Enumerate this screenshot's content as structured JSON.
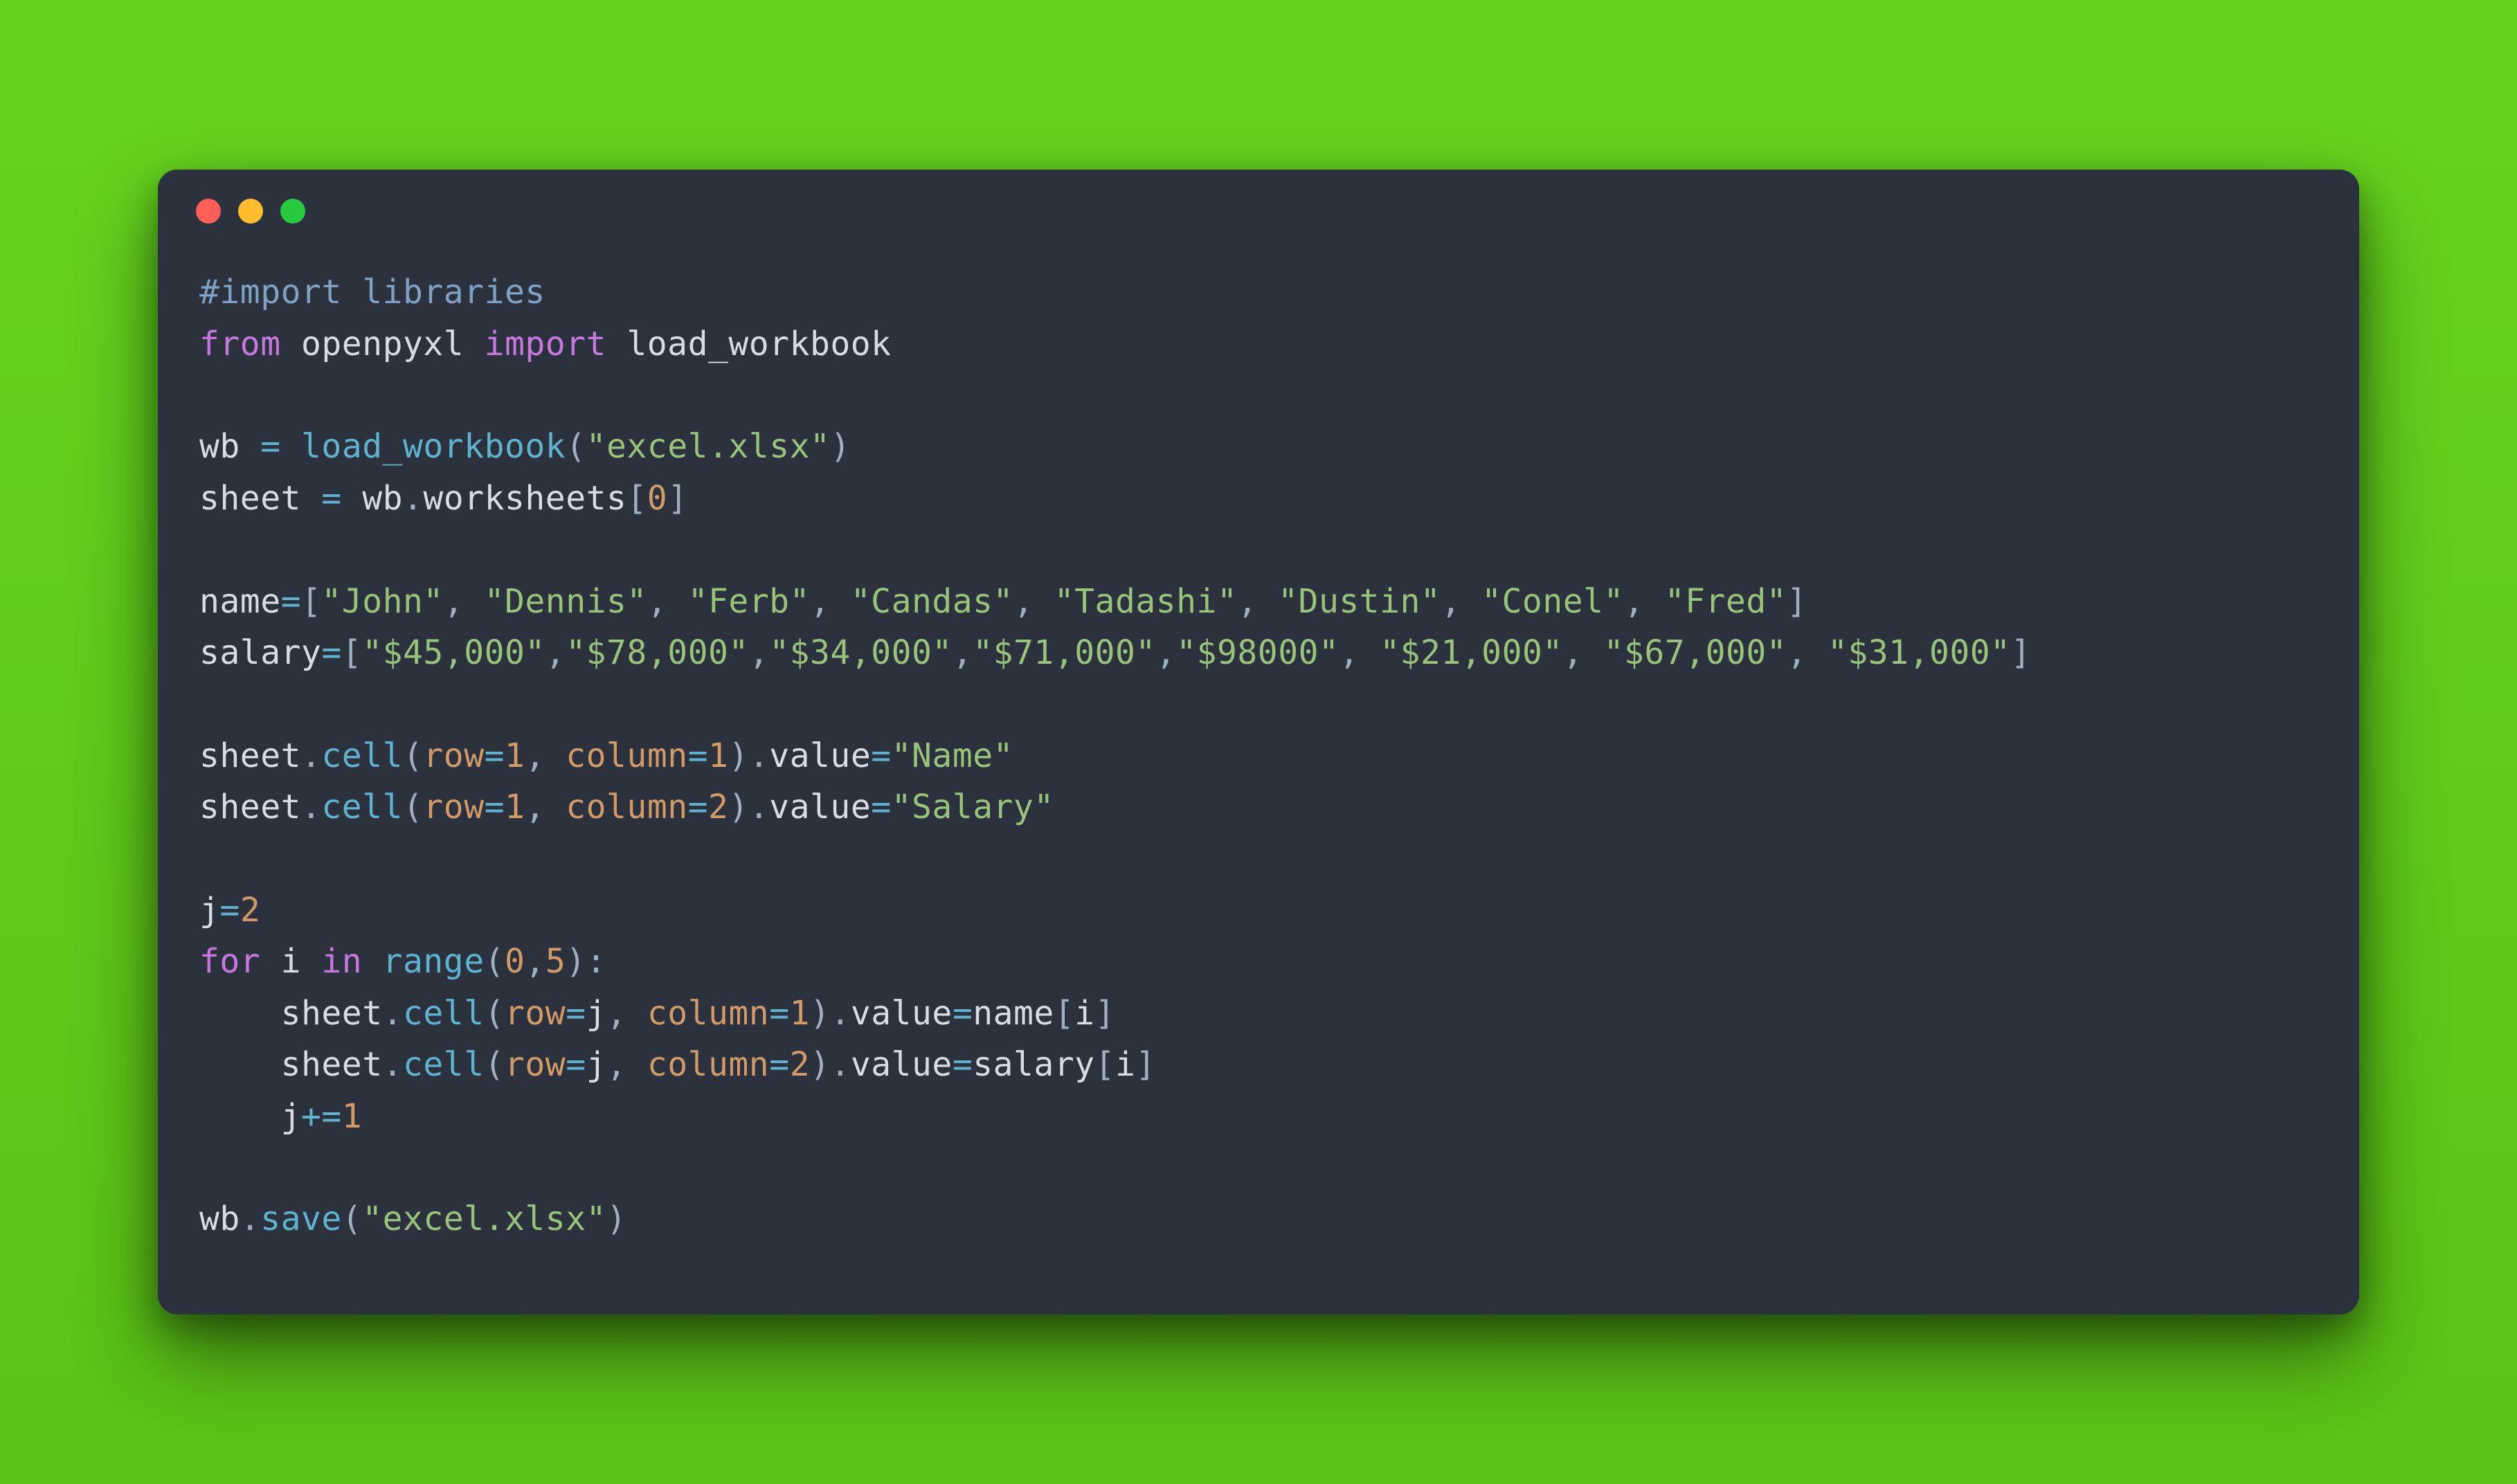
{
  "code": {
    "language": "python",
    "tokens": [
      [
        {
          "c": "tok-comment",
          "t": "#import libraries"
        }
      ],
      [
        {
          "c": "tok-kw",
          "t": "from"
        },
        {
          "c": "tok-ident",
          "t": " openpyxl "
        },
        {
          "c": "tok-kw",
          "t": "import"
        },
        {
          "c": "tok-ident",
          "t": " load_workbook"
        }
      ],
      [],
      [
        {
          "c": "tok-ident",
          "t": "wb "
        },
        {
          "c": "tok-op",
          "t": "="
        },
        {
          "c": "tok-ident",
          "t": " "
        },
        {
          "c": "tok-func",
          "t": "load_workbook"
        },
        {
          "c": "tok-punct",
          "t": "("
        },
        {
          "c": "tok-str",
          "t": "\"excel.xlsx\""
        },
        {
          "c": "tok-punct",
          "t": ")"
        }
      ],
      [
        {
          "c": "tok-ident",
          "t": "sheet "
        },
        {
          "c": "tok-op",
          "t": "="
        },
        {
          "c": "tok-ident",
          "t": " wb"
        },
        {
          "c": "tok-punct",
          "t": "."
        },
        {
          "c": "tok-ident",
          "t": "worksheets"
        },
        {
          "c": "tok-punct",
          "t": "["
        },
        {
          "c": "tok-num",
          "t": "0"
        },
        {
          "c": "tok-punct",
          "t": "]"
        }
      ],
      [],
      [
        {
          "c": "tok-ident",
          "t": "name"
        },
        {
          "c": "tok-op",
          "t": "="
        },
        {
          "c": "tok-punct",
          "t": "["
        },
        {
          "c": "tok-str",
          "t": "\"John\""
        },
        {
          "c": "tok-punct",
          "t": ", "
        },
        {
          "c": "tok-str",
          "t": "\"Dennis\""
        },
        {
          "c": "tok-punct",
          "t": ", "
        },
        {
          "c": "tok-str",
          "t": "\"Ferb\""
        },
        {
          "c": "tok-punct",
          "t": ", "
        },
        {
          "c": "tok-str",
          "t": "\"Candas\""
        },
        {
          "c": "tok-punct",
          "t": ", "
        },
        {
          "c": "tok-str",
          "t": "\"Tadashi\""
        },
        {
          "c": "tok-punct",
          "t": ", "
        },
        {
          "c": "tok-str",
          "t": "\"Dustin\""
        },
        {
          "c": "tok-punct",
          "t": ", "
        },
        {
          "c": "tok-str",
          "t": "\"Conel\""
        },
        {
          "c": "tok-punct",
          "t": ", "
        },
        {
          "c": "tok-str",
          "t": "\"Fred\""
        },
        {
          "c": "tok-punct",
          "t": "]"
        }
      ],
      [
        {
          "c": "tok-ident",
          "t": "salary"
        },
        {
          "c": "tok-op",
          "t": "="
        },
        {
          "c": "tok-punct",
          "t": "["
        },
        {
          "c": "tok-str",
          "t": "\"$45,000\""
        },
        {
          "c": "tok-punct",
          "t": ","
        },
        {
          "c": "tok-str",
          "t": "\"$78,000\""
        },
        {
          "c": "tok-punct",
          "t": ","
        },
        {
          "c": "tok-str",
          "t": "\"$34,000\""
        },
        {
          "c": "tok-punct",
          "t": ","
        },
        {
          "c": "tok-str",
          "t": "\"$71,000\""
        },
        {
          "c": "tok-punct",
          "t": ","
        },
        {
          "c": "tok-str",
          "t": "\"$98000\""
        },
        {
          "c": "tok-punct",
          "t": ", "
        },
        {
          "c": "tok-str",
          "t": "\"$21,000\""
        },
        {
          "c": "tok-punct",
          "t": ", "
        },
        {
          "c": "tok-str",
          "t": "\"$67,000\""
        },
        {
          "c": "tok-punct",
          "t": ", "
        },
        {
          "c": "tok-str",
          "t": "\"$31,000\""
        },
        {
          "c": "tok-punct",
          "t": "]"
        }
      ],
      [],
      [
        {
          "c": "tok-ident",
          "t": "sheet"
        },
        {
          "c": "tok-punct",
          "t": "."
        },
        {
          "c": "tok-func",
          "t": "cell"
        },
        {
          "c": "tok-punct",
          "t": "("
        },
        {
          "c": "tok-param",
          "t": "row"
        },
        {
          "c": "tok-op",
          "t": "="
        },
        {
          "c": "tok-num",
          "t": "1"
        },
        {
          "c": "tok-punct",
          "t": ", "
        },
        {
          "c": "tok-param",
          "t": "column"
        },
        {
          "c": "tok-op",
          "t": "="
        },
        {
          "c": "tok-num",
          "t": "1"
        },
        {
          "c": "tok-punct",
          "t": ")."
        },
        {
          "c": "tok-ident",
          "t": "value"
        },
        {
          "c": "tok-op",
          "t": "="
        },
        {
          "c": "tok-str",
          "t": "\"Name\""
        }
      ],
      [
        {
          "c": "tok-ident",
          "t": "sheet"
        },
        {
          "c": "tok-punct",
          "t": "."
        },
        {
          "c": "tok-func",
          "t": "cell"
        },
        {
          "c": "tok-punct",
          "t": "("
        },
        {
          "c": "tok-param",
          "t": "row"
        },
        {
          "c": "tok-op",
          "t": "="
        },
        {
          "c": "tok-num",
          "t": "1"
        },
        {
          "c": "tok-punct",
          "t": ", "
        },
        {
          "c": "tok-param",
          "t": "column"
        },
        {
          "c": "tok-op",
          "t": "="
        },
        {
          "c": "tok-num",
          "t": "2"
        },
        {
          "c": "tok-punct",
          "t": ")."
        },
        {
          "c": "tok-ident",
          "t": "value"
        },
        {
          "c": "tok-op",
          "t": "="
        },
        {
          "c": "tok-str",
          "t": "\"Salary\""
        }
      ],
      [],
      [
        {
          "c": "tok-ident",
          "t": "j"
        },
        {
          "c": "tok-op",
          "t": "="
        },
        {
          "c": "tok-num",
          "t": "2"
        }
      ],
      [
        {
          "c": "tok-kw",
          "t": "for"
        },
        {
          "c": "tok-ident",
          "t": " i "
        },
        {
          "c": "tok-kw",
          "t": "in"
        },
        {
          "c": "tok-ident",
          "t": " "
        },
        {
          "c": "tok-func",
          "t": "range"
        },
        {
          "c": "tok-punct",
          "t": "("
        },
        {
          "c": "tok-num",
          "t": "0"
        },
        {
          "c": "tok-punct",
          "t": ","
        },
        {
          "c": "tok-num",
          "t": "5"
        },
        {
          "c": "tok-punct",
          "t": "):"
        }
      ],
      [
        {
          "c": "tok-ident",
          "t": "    sheet"
        },
        {
          "c": "tok-punct",
          "t": "."
        },
        {
          "c": "tok-func",
          "t": "cell"
        },
        {
          "c": "tok-punct",
          "t": "("
        },
        {
          "c": "tok-param",
          "t": "row"
        },
        {
          "c": "tok-op",
          "t": "="
        },
        {
          "c": "tok-ident",
          "t": "j"
        },
        {
          "c": "tok-punct",
          "t": ", "
        },
        {
          "c": "tok-param",
          "t": "column"
        },
        {
          "c": "tok-op",
          "t": "="
        },
        {
          "c": "tok-num",
          "t": "1"
        },
        {
          "c": "tok-punct",
          "t": ")."
        },
        {
          "c": "tok-ident",
          "t": "value"
        },
        {
          "c": "tok-op",
          "t": "="
        },
        {
          "c": "tok-ident",
          "t": "name"
        },
        {
          "c": "tok-punct",
          "t": "["
        },
        {
          "c": "tok-ident",
          "t": "i"
        },
        {
          "c": "tok-punct",
          "t": "]"
        }
      ],
      [
        {
          "c": "tok-ident",
          "t": "    sheet"
        },
        {
          "c": "tok-punct",
          "t": "."
        },
        {
          "c": "tok-func",
          "t": "cell"
        },
        {
          "c": "tok-punct",
          "t": "("
        },
        {
          "c": "tok-param",
          "t": "row"
        },
        {
          "c": "tok-op",
          "t": "="
        },
        {
          "c": "tok-ident",
          "t": "j"
        },
        {
          "c": "tok-punct",
          "t": ", "
        },
        {
          "c": "tok-param",
          "t": "column"
        },
        {
          "c": "tok-op",
          "t": "="
        },
        {
          "c": "tok-num",
          "t": "2"
        },
        {
          "c": "tok-punct",
          "t": ")."
        },
        {
          "c": "tok-ident",
          "t": "value"
        },
        {
          "c": "tok-op",
          "t": "="
        },
        {
          "c": "tok-ident",
          "t": "salary"
        },
        {
          "c": "tok-punct",
          "t": "["
        },
        {
          "c": "tok-ident",
          "t": "i"
        },
        {
          "c": "tok-punct",
          "t": "]"
        }
      ],
      [
        {
          "c": "tok-ident",
          "t": "    j"
        },
        {
          "c": "tok-op",
          "t": "+="
        },
        {
          "c": "tok-num",
          "t": "1"
        }
      ],
      [],
      [
        {
          "c": "tok-ident",
          "t": "wb"
        },
        {
          "c": "tok-punct",
          "t": "."
        },
        {
          "c": "tok-func",
          "t": "save"
        },
        {
          "c": "tok-punct",
          "t": "("
        },
        {
          "c": "tok-str",
          "t": "\"excel.xlsx\""
        },
        {
          "c": "tok-punct",
          "t": ")"
        }
      ]
    ]
  },
  "colors": {
    "bg_outer": "#5fcf1a",
    "bg_window": "#2b313d",
    "dot_close": "#ff5f56",
    "dot_min": "#ffbd2e",
    "dot_max": "#27c93f"
  }
}
